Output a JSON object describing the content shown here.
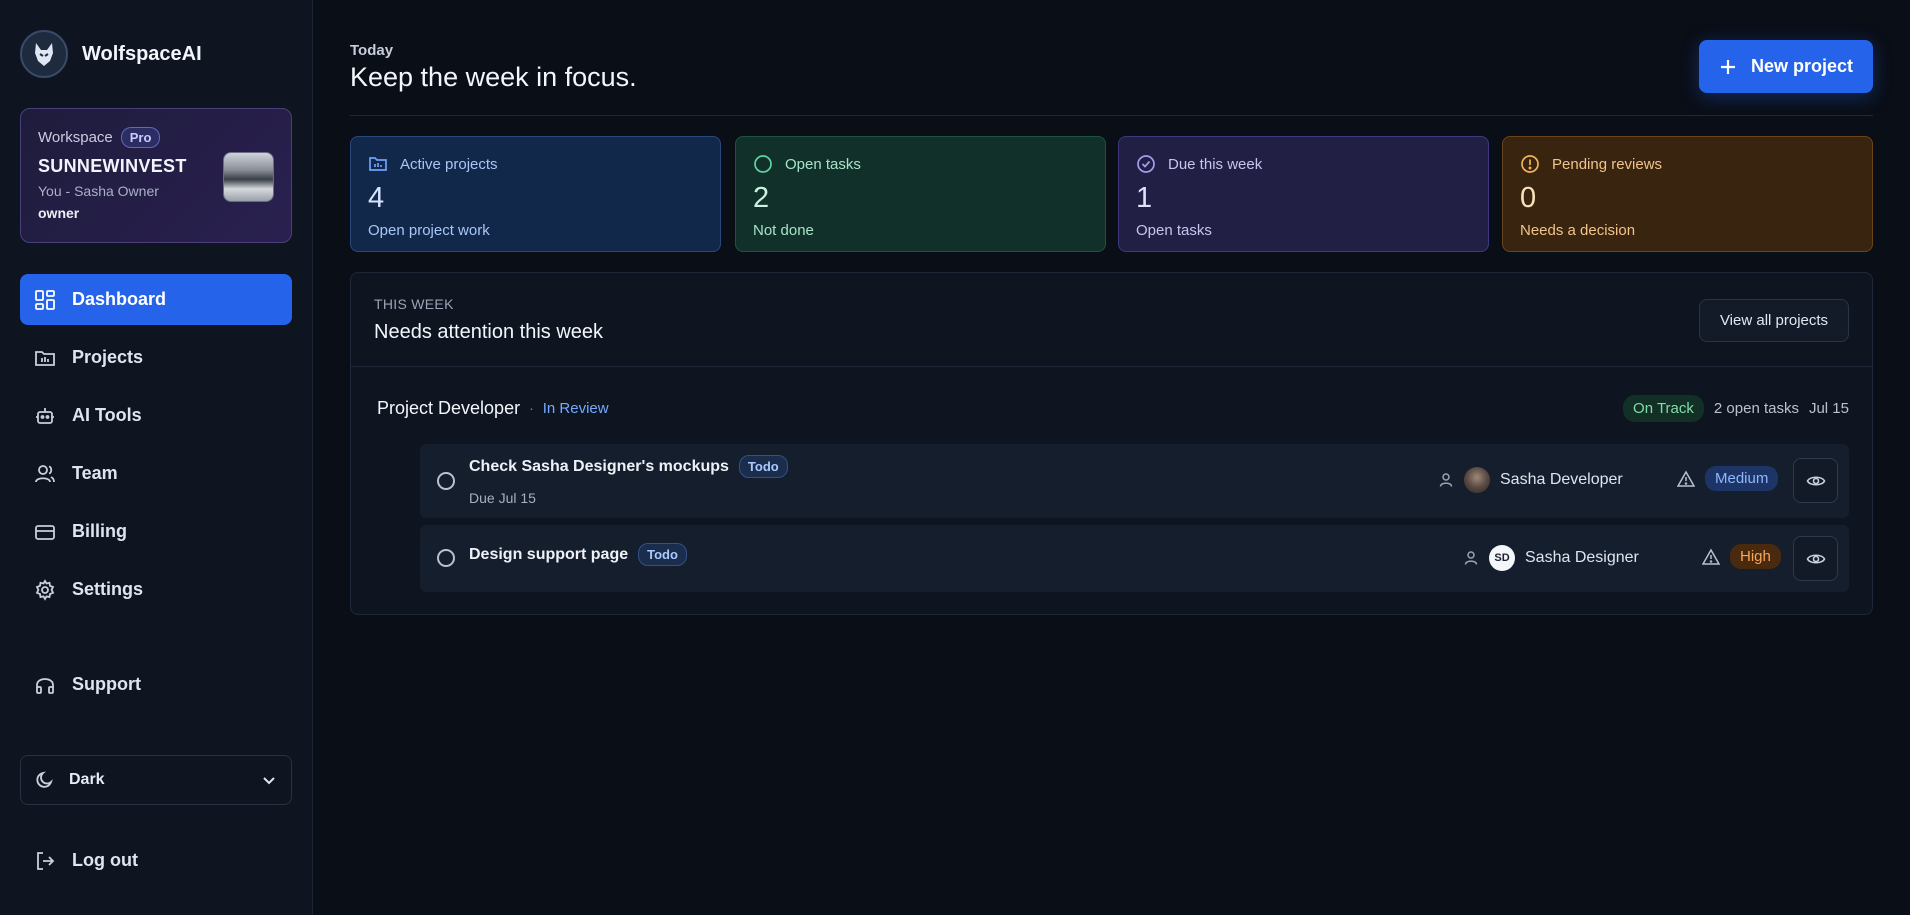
{
  "brand": {
    "name": "WolfspaceAI",
    "logo_icon": "wolf-logo-icon"
  },
  "workspace": {
    "label": "Workspace",
    "plan_badge": "Pro",
    "name": "SUNNEWINVEST",
    "user_line": "You - Sasha Owner",
    "role": "owner"
  },
  "nav": [
    {
      "label": "Dashboard",
      "icon": "dashboard-icon",
      "active": true
    },
    {
      "label": "Projects",
      "icon": "folder-chart-icon",
      "active": false
    },
    {
      "label": "AI Tools",
      "icon": "bot-icon",
      "active": false
    },
    {
      "label": "Team",
      "icon": "users-icon",
      "active": false
    },
    {
      "label": "Billing",
      "icon": "credit-card-icon",
      "active": false
    },
    {
      "label": "Settings",
      "icon": "gear-icon",
      "active": false
    }
  ],
  "support": {
    "label": "Support",
    "icon": "headphones-icon"
  },
  "theme": {
    "label": "Dark",
    "icon": "moon-icon"
  },
  "logout": {
    "label": "Log out",
    "icon": "logout-icon"
  },
  "header": {
    "eyebrow": "Today",
    "title": "Keep the week in focus.",
    "new_project_label": "New project"
  },
  "stats": [
    {
      "label": "Active projects",
      "value": "4",
      "sub": "Open project work",
      "color": "#3b82f6"
    },
    {
      "label": "Open tasks",
      "value": "2",
      "sub": "Not done",
      "color": "#34d399"
    },
    {
      "label": "Due this week",
      "value": "1",
      "sub": "Open tasks",
      "color": "#a78bfa"
    },
    {
      "label": "Pending reviews",
      "value": "0",
      "sub": "Needs a decision",
      "color": "#f59e0b"
    }
  ],
  "week_panel": {
    "eyebrow": "THIS WEEK",
    "title": "Needs attention this week",
    "view_all_label": "View all projects",
    "project": {
      "name": "Project Developer",
      "separator": "·",
      "status": "In Review",
      "health": "On Track",
      "open_tasks": "2 open tasks",
      "due": "Jul 15"
    },
    "tasks": [
      {
        "title": "Check Sasha Designer's mockups",
        "badge": "Todo",
        "due": "Due Jul 15",
        "assignee": "Sasha Developer",
        "priority": "Medium"
      },
      {
        "title": "Design support page",
        "badge": "Todo",
        "due": "",
        "assignee": "Sasha Designer",
        "assignee_initials": "SD",
        "priority": "High"
      }
    ]
  }
}
